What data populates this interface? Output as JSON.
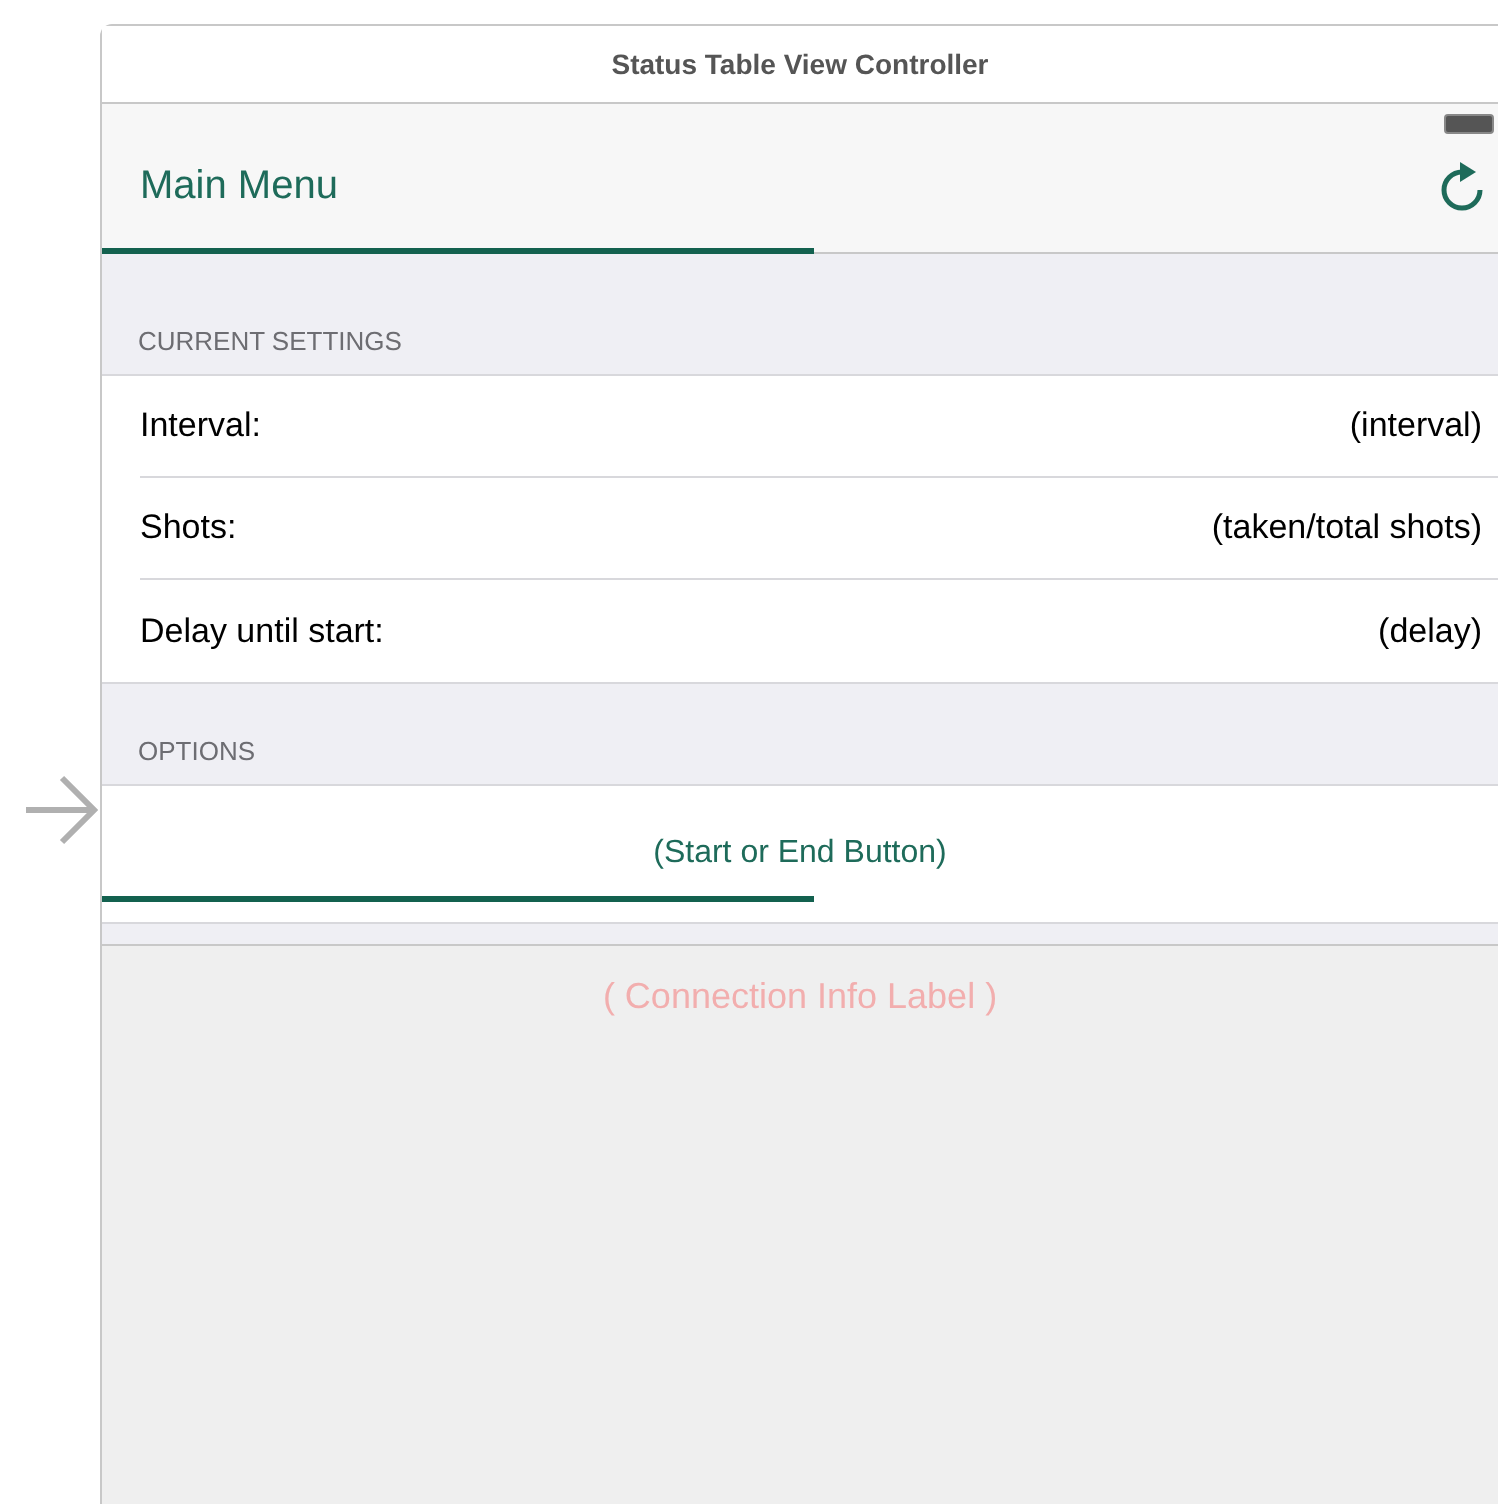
{
  "window": {
    "title": "Status Table View Controller"
  },
  "nav_bar": {
    "title": "Main Menu",
    "progress": {
      "level": 0.51
    }
  },
  "sections": [
    {
      "header": "CURRENT SETTINGS",
      "rows": [
        {
          "label": "Interval:",
          "value": "(interval)"
        },
        {
          "label": "Shots:",
          "value": "(taken/total shots)"
        },
        {
          "label": "Delay until start:",
          "value": "(delay)"
        }
      ]
    },
    {
      "header": "OPTIONS",
      "button": {
        "label": "(Start or End Button)",
        "progress": {
          "level": 0.51
        }
      }
    }
  ],
  "connection_label": "( Connection Info Label )"
}
